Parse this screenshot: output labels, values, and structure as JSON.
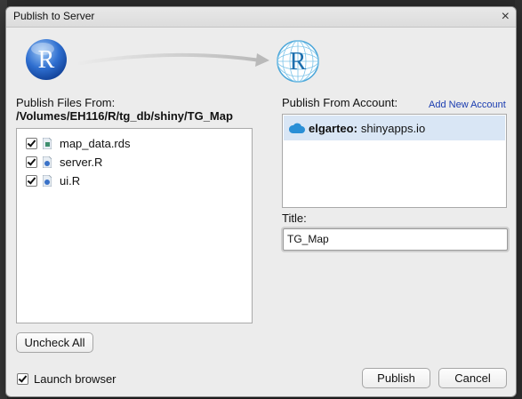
{
  "dialog": {
    "title": "Publish to Server",
    "close_glyph": "×"
  },
  "source": {
    "label": "Publish Files From:",
    "path": "/Volumes/EH116/R/tg_db/shiny/TG_Map",
    "files": [
      {
        "name": "map_data.rds",
        "checked": true,
        "icon": "rds-file-icon"
      },
      {
        "name": "server.R",
        "checked": true,
        "icon": "r-file-icon"
      },
      {
        "name": "ui.R",
        "checked": true,
        "icon": "r-file-icon"
      }
    ]
  },
  "account": {
    "label": "Publish From Account:",
    "add_link": "Add New Account",
    "items": [
      {
        "name": "elgarteo:",
        "server": "shinyapps.io",
        "icon": "cloud-icon",
        "selected": true
      }
    ]
  },
  "title_field": {
    "label": "Title:",
    "value": "TG_Map"
  },
  "buttons": {
    "uncheck_all": "Uncheck All",
    "publish": "Publish",
    "cancel": "Cancel"
  },
  "launch_browser": {
    "label": "Launch browser",
    "checked": true
  },
  "logos": {
    "source_letter": "R",
    "target_letter": "R"
  },
  "colors": {
    "selection": "#d9e6f5",
    "link": "#1a3cb0",
    "cloud": "#2a8fd6"
  }
}
